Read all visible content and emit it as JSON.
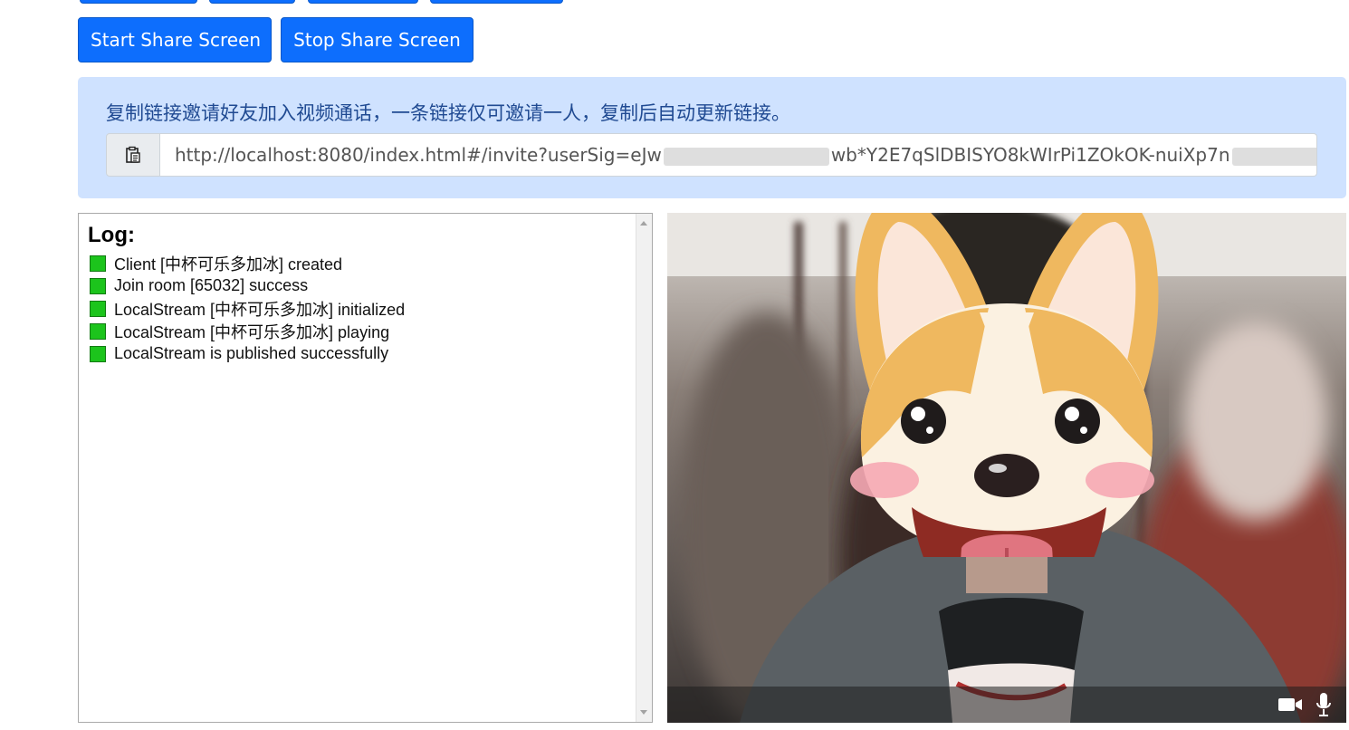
{
  "buttons": {
    "start_share": "Start Share Screen",
    "stop_share": "Stop Share Screen"
  },
  "invite": {
    "message": "复制链接邀请好友加入视频通话，一条链接仅可邀请一人，复制后自动更新链接。",
    "copy_icon": "clipboard-icon",
    "link_value_part1": "http://localhost:8080/index.html#/invite?userSig=eJw",
    "link_value_part2": "wb*Y2E7qSlDBISYO8kWIrPi1ZOkOK-nuiXp7n"
  },
  "log": {
    "title": "Log:",
    "entries": [
      "Client [中杯可乐多加冰] created",
      "Join room [65032] success",
      "LocalStream [中杯可乐多加冰] initialized",
      "LocalStream [中杯可乐多加冰] playing",
      "LocalStream is published successfully"
    ],
    "status_color": "#1cc41c"
  },
  "video": {
    "camera_icon": "camera-icon",
    "mic_icon": "microphone-icon",
    "overlay_sticker": "corgi-face-sticker"
  },
  "colors": {
    "primary": "#0d6efd",
    "alert_bg": "#cfe2ff",
    "alert_text": "#204a92"
  }
}
